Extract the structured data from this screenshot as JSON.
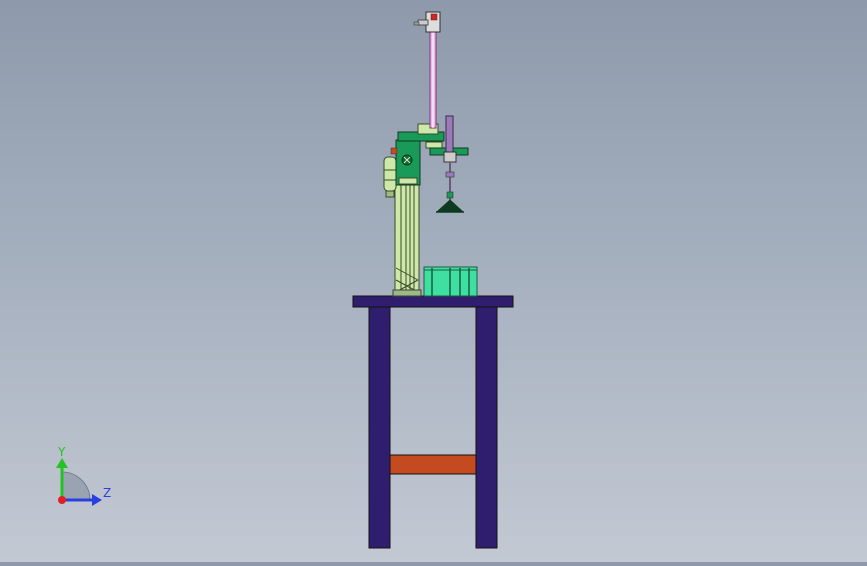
{
  "viewport": {
    "background_top": "#8e9aab",
    "background_bottom": "#c3c9d3"
  },
  "model": {
    "table_color": "#2f1e6e",
    "crossbar_color": "#c44a1f",
    "frame_color": "#cde8a8",
    "head_color": "#1a9a58",
    "bin_color": "#3ee0a0",
    "column_color": "#e9b8e9"
  },
  "triad": {
    "y_label": "Y",
    "z_label": "Z",
    "y_color": "#22c322",
    "z_color": "#2a3fe0",
    "origin_color": "#e02020"
  }
}
